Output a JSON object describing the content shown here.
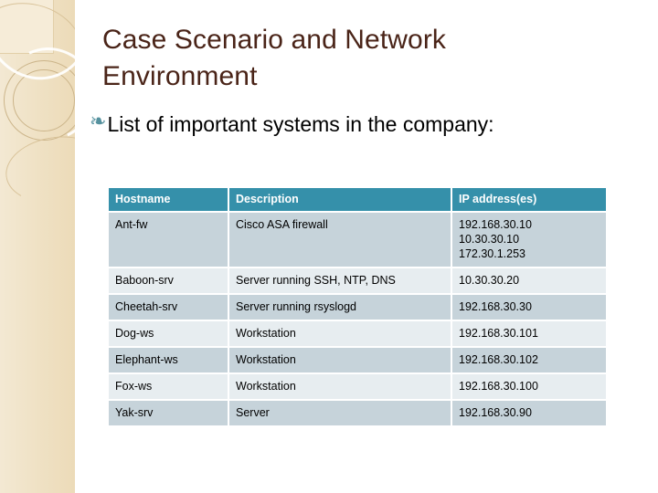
{
  "slide": {
    "title": "Case Scenario and Network Environment",
    "bullet": {
      "glyph": "❧",
      "text": "List of important systems in the company:"
    }
  },
  "colors": {
    "title": "#4a2418",
    "table_header_bg": "#3590aa",
    "table_header_text": "#ffffff",
    "row_dark": "#c6d3da",
    "row_light": "#e7edf0",
    "bullet": "#55919e",
    "sidebar_band": "#eedfc0"
  },
  "table": {
    "columns": [
      "Hostname",
      "Description",
      "IP address(es)"
    ],
    "rows": [
      {
        "hostname": "Ant-fw",
        "description": "Cisco ASA firewall",
        "ips": [
          "192.168.30.10",
          "10.30.30.10",
          "172.30.1.253"
        ]
      },
      {
        "hostname": "Baboon-srv",
        "description": "Server running SSH, NTP, DNS",
        "ips": [
          "10.30.30.20"
        ]
      },
      {
        "hostname": "Cheetah-srv",
        "description": "Server running rsyslogd",
        "ips": [
          "192.168.30.30"
        ]
      },
      {
        "hostname": "Dog-ws",
        "description": "Workstation",
        "ips": [
          "192.168.30.101"
        ]
      },
      {
        "hostname": "Elephant-ws",
        "description": "Workstation",
        "ips": [
          "192.168.30.102"
        ]
      },
      {
        "hostname": "Fox-ws",
        "description": "Workstation",
        "ips": [
          "192.168.30.100"
        ]
      },
      {
        "hostname": "Yak-srv",
        "description": "Server",
        "ips": [
          "192.168.30.90"
        ]
      }
    ]
  }
}
